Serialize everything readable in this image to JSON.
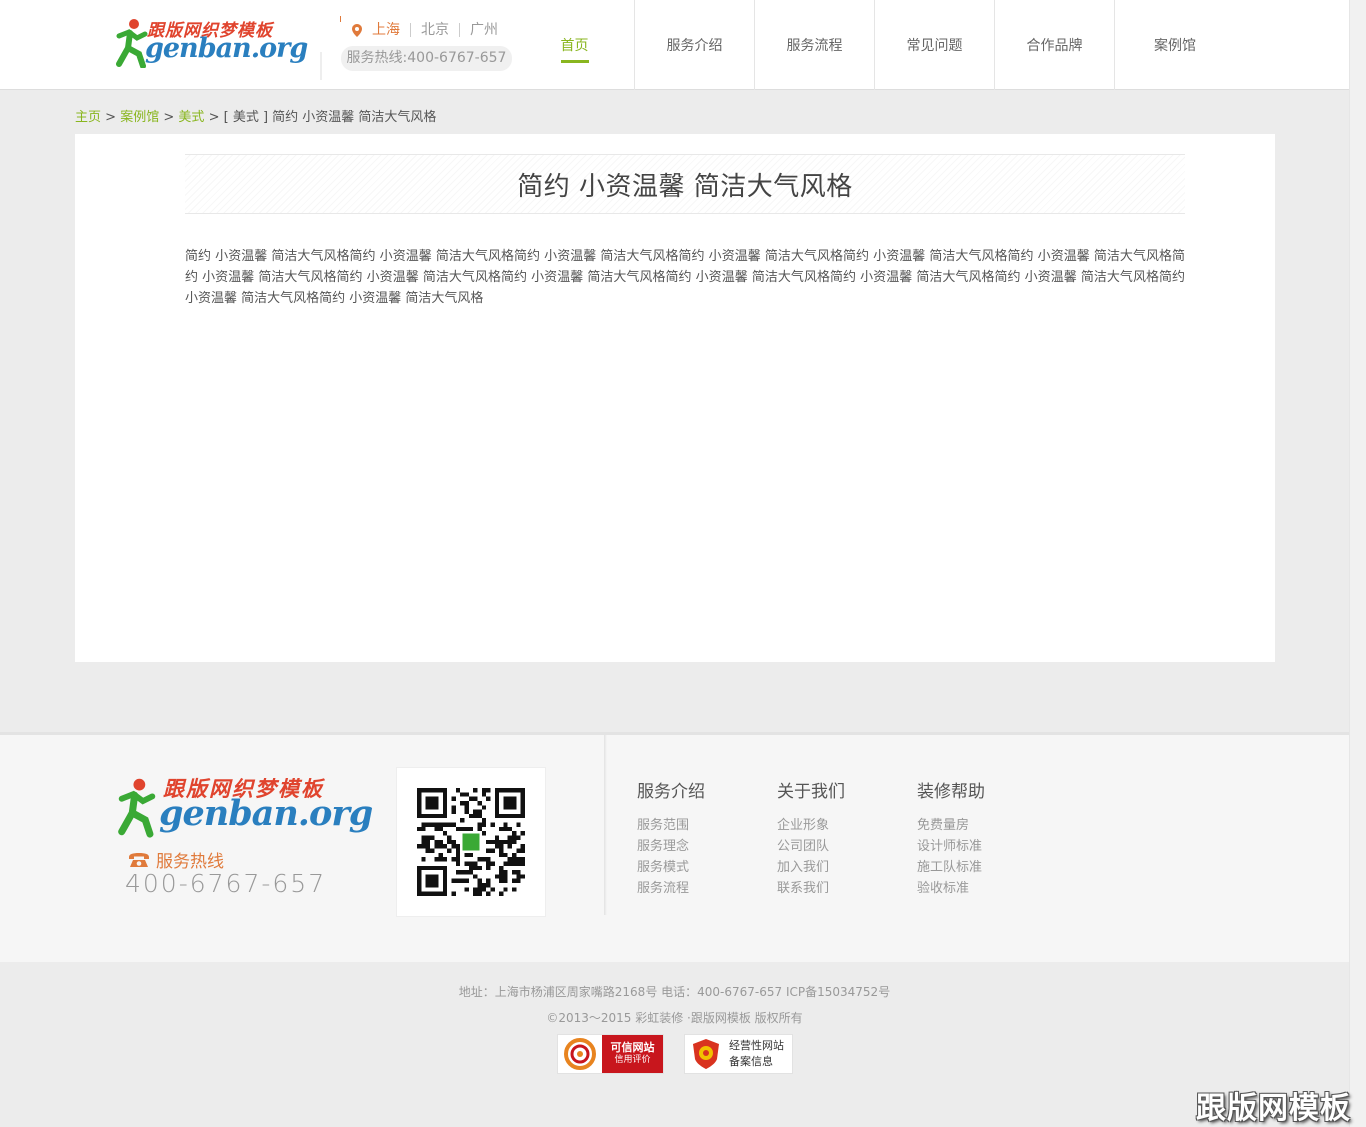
{
  "brand": {
    "logo_cn": "跟版网织梦模板",
    "logo_en": "genban.org"
  },
  "header": {
    "cities": [
      "上海",
      "北京",
      "广州"
    ],
    "hotline": "服务热线:400-6767-657",
    "nav": [
      {
        "label": "首页",
        "active": true
      },
      {
        "label": "服务介绍"
      },
      {
        "label": "服务流程"
      },
      {
        "label": "常见问题"
      },
      {
        "label": "合作品牌"
      },
      {
        "label": "案例馆"
      }
    ]
  },
  "breadcrumb": {
    "items": [
      "主页",
      "案例馆",
      "美式"
    ],
    "separator": ">",
    "current": "[ 美式 ] 简约 小资温馨 简洁大气风格"
  },
  "article": {
    "title": "简约 小资温馨 简洁大气风格",
    "body": "简约 小资温馨 简洁大气风格简约 小资温馨 简洁大气风格简约 小资温馨 简洁大气风格简约 小资温馨 简洁大气风格简约 小资温馨 简洁大气风格简约 小资温馨 简洁大气风格简约 小资温馨 简洁大气风格简约 小资温馨 简洁大气风格简约 小资温馨 简洁大气风格简约 小资温馨 简洁大气风格简约 小资温馨 简洁大气风格简约 小资温馨 简洁大气风格简约 小资温馨 简洁大气风格简约 小资温馨 简洁大气风格"
  },
  "footer": {
    "hotline_label": "服务热线",
    "hotline_number": "400-6767-657",
    "columns": [
      {
        "title": "服务介绍",
        "links": [
          "服务范围",
          "服务理念",
          "服务模式",
          "服务流程"
        ]
      },
      {
        "title": "关于我们",
        "links": [
          "企业形象",
          "公司团队",
          "加入我们",
          "联系我们"
        ]
      },
      {
        "title": "装修帮助",
        "links": [
          "免费量房",
          "设计师标准",
          "施工队标准",
          "验收标准"
        ]
      }
    ],
    "address_line": "地址：上海市杨浦区周家嘴路2168号  电话：400-6767-657   ICP备15034752号",
    "copyright": "©2013～2015 彩虹装修 ·跟版网模板 版权所有",
    "badges": {
      "credit_line1": "可信网站",
      "credit_line2": "信用评价",
      "icp_line1": "经营性网站",
      "icp_line2": "备案信息"
    }
  },
  "watermark": "跟版网模板",
  "colors": {
    "accent_green": "#89b61f",
    "accent_orange": "#e07a3b",
    "logo_red": "#e0442e",
    "logo_blue": "#2a7fbf"
  }
}
